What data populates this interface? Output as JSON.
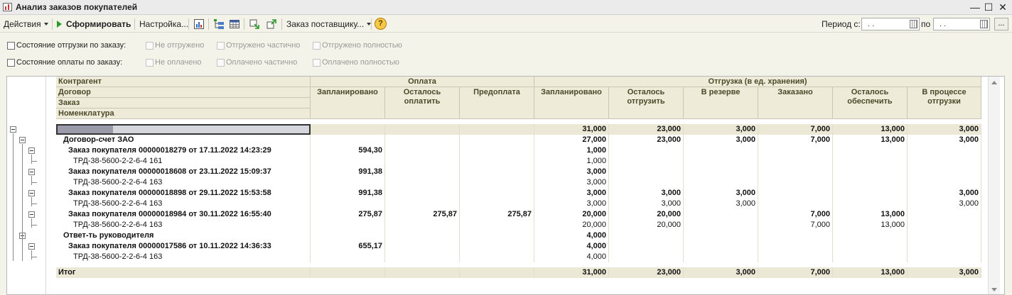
{
  "window": {
    "title": "Анализ заказов покупателей",
    "min": "—",
    "max": "☐",
    "close": "✕"
  },
  "toolbar": {
    "actions": "Действия",
    "generate": "Сформировать",
    "settings": "Настройка...",
    "supplier_order": "Заказ поставщику...",
    "help": "?",
    "period_from_label": "Период с:",
    "period_to_label": "по",
    "date_from": " .  .",
    "date_to": " .  .",
    "more": "..."
  },
  "filters": {
    "shipment": {
      "label": "Состояние отгрузки по заказу:",
      "options": [
        "Не отгружено",
        "Отгружено частично",
        "Отгружено полностью"
      ]
    },
    "payment": {
      "label": "Состояние оплаты по заказу:",
      "options": [
        "Не оплачено",
        "Оплачено частично",
        "Оплачено полностью"
      ]
    }
  },
  "headers": {
    "left": [
      "Контрагент",
      "Договор",
      "Заказ",
      "Номенклатура"
    ],
    "payment_group": "Оплата",
    "shipment_group": "Отгрузка (в ед. хранения)",
    "cols": [
      "Запланировано",
      "Осталось оплатить",
      "Предоплата",
      "Запланировано",
      "Осталось отгрузить",
      "В резерве",
      "Заказано",
      "Осталось обеспечить",
      "В процессе отгрузки"
    ]
  },
  "rows": [
    {
      "level": 0,
      "band": true,
      "name": "",
      "vals": [
        "",
        "",
        "",
        "31,000",
        "23,000",
        "3,000",
        "7,000",
        "13,000",
        "3,000"
      ]
    },
    {
      "level": 1,
      "bold": true,
      "name": "Договор-счет ЗАО",
      "vals": [
        "",
        "",
        "",
        "27,000",
        "23,000",
        "3,000",
        "7,000",
        "13,000",
        "3,000"
      ]
    },
    {
      "level": 2,
      "bold": true,
      "name": "Заказ покупателя 00000018279 от 17.11.2022 14:23:29",
      "vals": [
        "594,30",
        "",
        "",
        "1,000",
        "",
        "",
        "",
        "",
        ""
      ]
    },
    {
      "level": 3,
      "name": "ТРД-38-5600-2-2-6-4 161",
      "vals": [
        "",
        "",
        "",
        "1,000",
        "",
        "",
        "",
        "",
        ""
      ]
    },
    {
      "level": 2,
      "bold": true,
      "name": "Заказ покупателя 00000018608 от 23.11.2022 15:09:37",
      "vals": [
        "991,38",
        "",
        "",
        "3,000",
        "",
        "",
        "",
        "",
        ""
      ]
    },
    {
      "level": 3,
      "name": "ТРД-38-5600-2-2-6-4 163",
      "vals": [
        "",
        "",
        "",
        "3,000",
        "",
        "",
        "",
        "",
        ""
      ]
    },
    {
      "level": 2,
      "bold": true,
      "name": "Заказ покупателя 00000018898 от 29.11.2022 15:53:58",
      "vals": [
        "991,38",
        "",
        "",
        "3,000",
        "3,000",
        "3,000",
        "",
        "",
        "3,000"
      ]
    },
    {
      "level": 3,
      "name": "ТРД-38-5600-2-2-6-4 163",
      "vals": [
        "",
        "",
        "",
        "3,000",
        "3,000",
        "3,000",
        "",
        "",
        "3,000"
      ]
    },
    {
      "level": 2,
      "bold": true,
      "name": "Заказ покупателя 00000018984 от 30.11.2022 16:55:40",
      "vals": [
        "275,87",
        "275,87",
        "275,87",
        "20,000",
        "20,000",
        "",
        "7,000",
        "13,000",
        ""
      ]
    },
    {
      "level": 3,
      "name": "ТРД-38-5600-2-2-6-4 163",
      "vals": [
        "",
        "",
        "",
        "20,000",
        "20,000",
        "",
        "7,000",
        "13,000",
        ""
      ]
    },
    {
      "level": 1,
      "bold": true,
      "name": "Ответ-ть руководителя",
      "vals": [
        "",
        "",
        "",
        "4,000",
        "",
        "",
        "",
        "",
        ""
      ]
    },
    {
      "level": 2,
      "bold": true,
      "name": "Заказ покупателя 00000017586 от 10.11.2022 14:36:33",
      "vals": [
        "655,17",
        "",
        "",
        "4,000",
        "",
        "",
        "",
        "",
        ""
      ]
    },
    {
      "level": 3,
      "name": "ТРД-38-5600-2-2-6-4 163",
      "vals": [
        "",
        "",
        "",
        "4,000",
        "",
        "",
        "",
        "",
        ""
      ]
    }
  ],
  "total": {
    "name": "Итог",
    "vals": [
      "",
      "",
      "",
      "31,000",
      "23,000",
      "3,000",
      "7,000",
      "13,000",
      "3,000"
    ]
  }
}
